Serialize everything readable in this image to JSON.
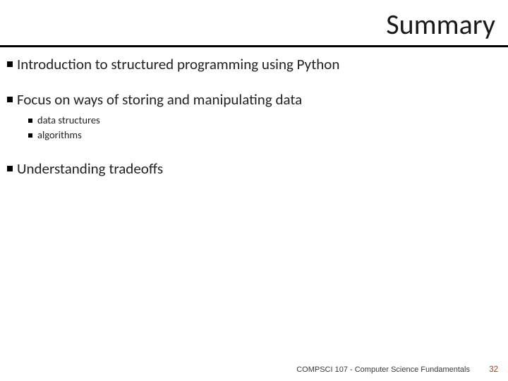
{
  "title": "Summary",
  "bullets": [
    {
      "level": 1,
      "text": "Introduction to structured programming using Python"
    },
    {
      "level": 1,
      "text": "Focus on ways of storing and manipulating data"
    },
    {
      "level": 2,
      "text": "data structures"
    },
    {
      "level": 2,
      "text": "algorithms"
    },
    {
      "level": 1,
      "text": "Understanding tradeoffs"
    }
  ],
  "footer": {
    "course": "COMPSCI 107 - Computer Science Fundamentals",
    "page": "32"
  }
}
